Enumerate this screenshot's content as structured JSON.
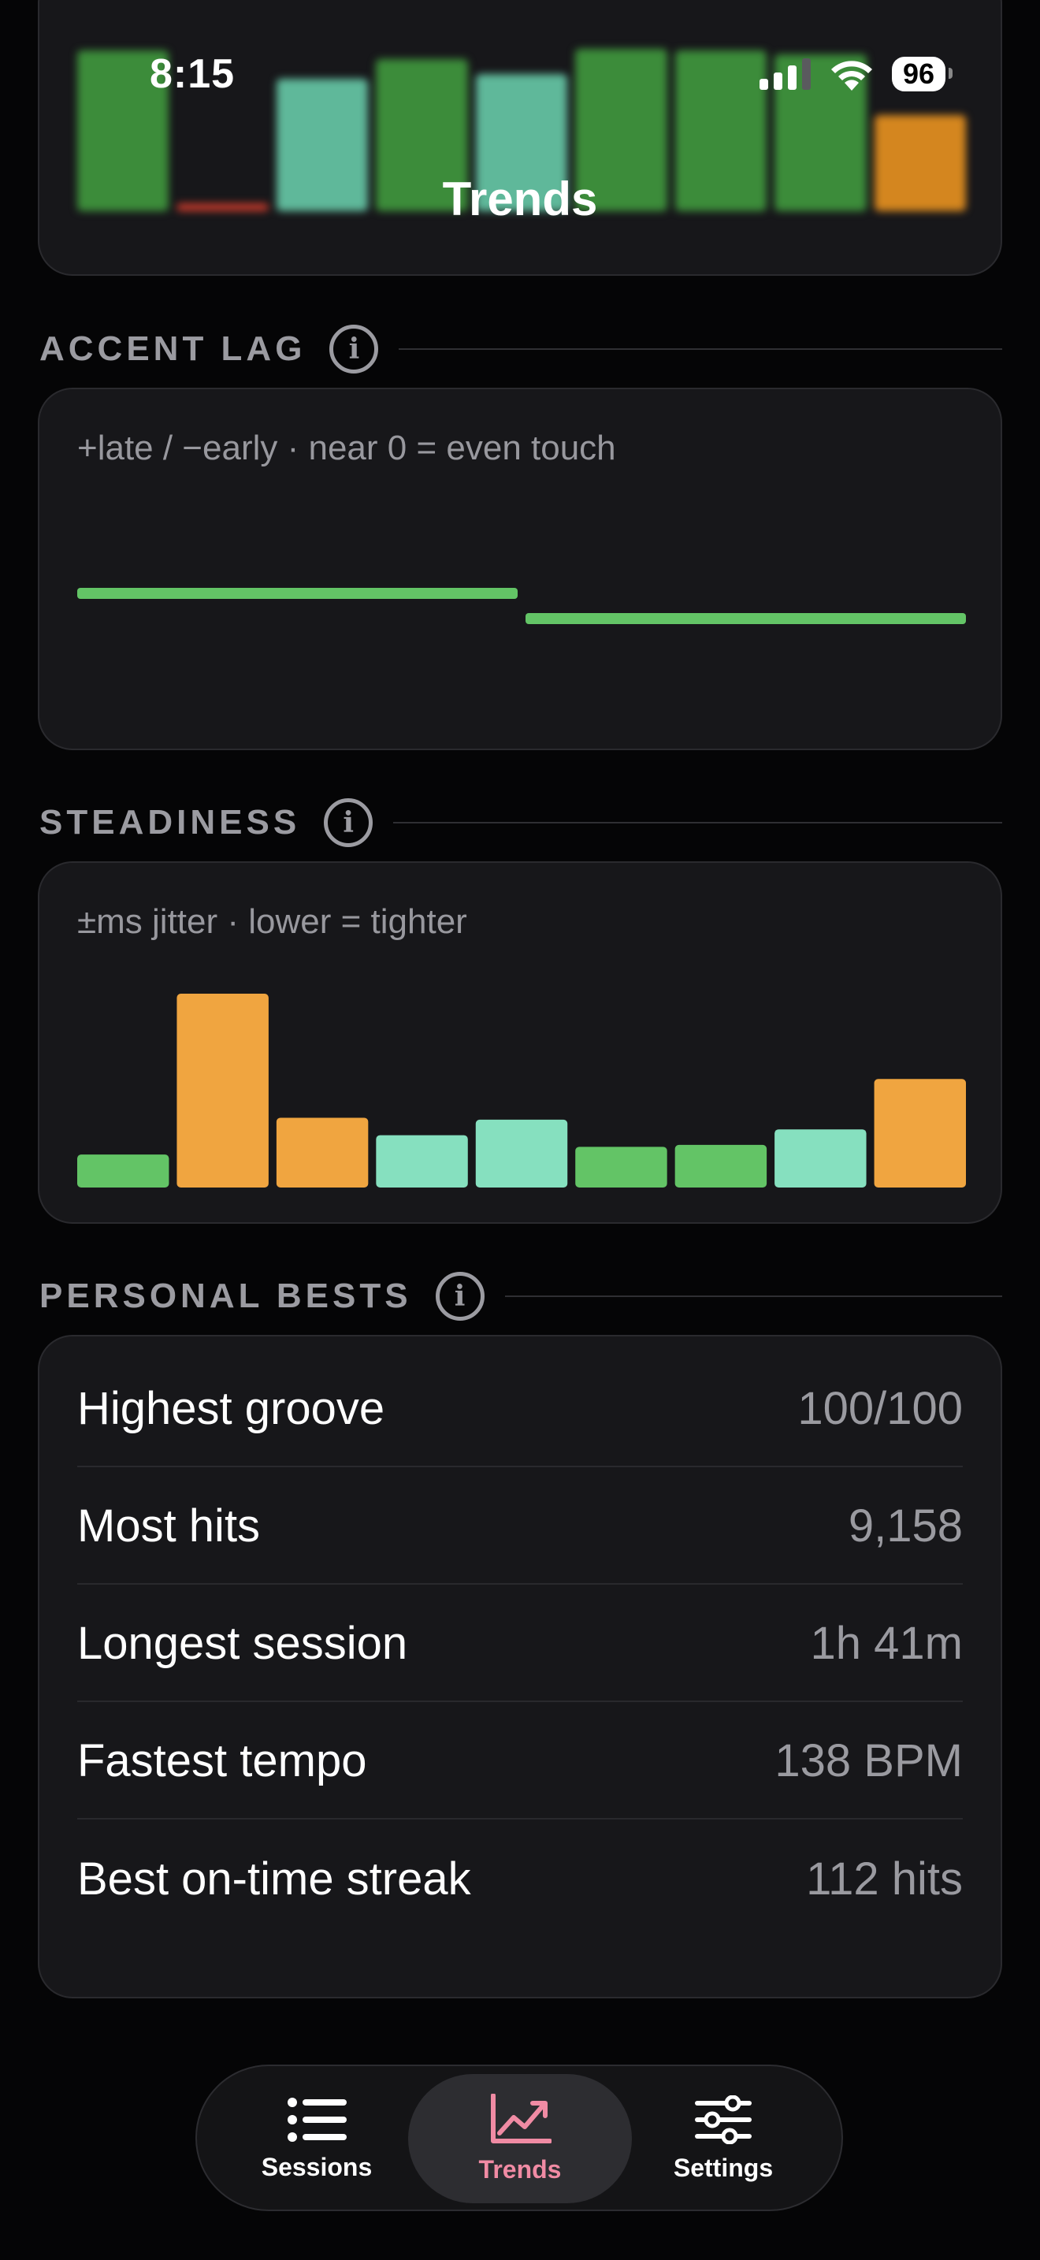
{
  "status_bar": {
    "time": "8:15",
    "battery": "96"
  },
  "header": {
    "title": "Trends"
  },
  "top_chart": {
    "bars": [
      {
        "value": 0.97,
        "color": "#3c8c3a"
      },
      {
        "value": 0.05,
        "color": "#c0392b"
      },
      {
        "value": 0.8,
        "color": "#5fb89a"
      },
      {
        "value": 0.92,
        "color": "#3c8c3a"
      },
      {
        "value": 0.83,
        "color": "#5fb89a"
      },
      {
        "value": 0.98,
        "color": "#3c8c3a"
      },
      {
        "value": 0.97,
        "color": "#3c8c3a"
      },
      {
        "value": 0.95,
        "color": "#3c8c3a"
      },
      {
        "value": 0.58,
        "color": "#d4861f"
      }
    ]
  },
  "accent_lag": {
    "title": "ACCENT LAG",
    "subtitle": "+late / −early · near 0 = even touch",
    "chart_data": {
      "type": "bar",
      "segments": [
        {
          "value": 0.4,
          "color": "#63c466"
        },
        {
          "value": -0.4,
          "color": "#63c466"
        }
      ],
      "zero_line": false
    }
  },
  "steadiness": {
    "title": "STEADINESS",
    "subtitle": "±ms jitter · lower = tighter",
    "chart_data": {
      "type": "bar",
      "values": [
        {
          "value": 17,
          "color": "#63c466"
        },
        {
          "value": 100,
          "color": "#f0a540"
        },
        {
          "value": 36,
          "color": "#f0a540"
        },
        {
          "value": 27,
          "color": "#86e0bf"
        },
        {
          "value": 35,
          "color": "#86e0bf"
        },
        {
          "value": 21,
          "color": "#63c466"
        },
        {
          "value": 22,
          "color": "#63c466"
        },
        {
          "value": 30,
          "color": "#86e0bf"
        },
        {
          "value": 56,
          "color": "#f0a540"
        }
      ]
    }
  },
  "personal_bests": {
    "title": "PERSONAL BESTS",
    "rows": [
      {
        "label": "Highest groove",
        "value": "100/100"
      },
      {
        "label": "Most hits",
        "value": "9,158"
      },
      {
        "label": "Longest session",
        "value": "1h 41m"
      },
      {
        "label": "Fastest tempo",
        "value": "138 BPM"
      },
      {
        "label": "Best on-time streak",
        "value": "112 hits"
      }
    ]
  },
  "tabs": [
    {
      "label": "Sessions",
      "icon": "list-icon",
      "active": false
    },
    {
      "label": "Trends",
      "icon": "chart-icon",
      "active": true
    },
    {
      "label": "Settings",
      "icon": "sliders-icon",
      "active": false
    }
  ]
}
